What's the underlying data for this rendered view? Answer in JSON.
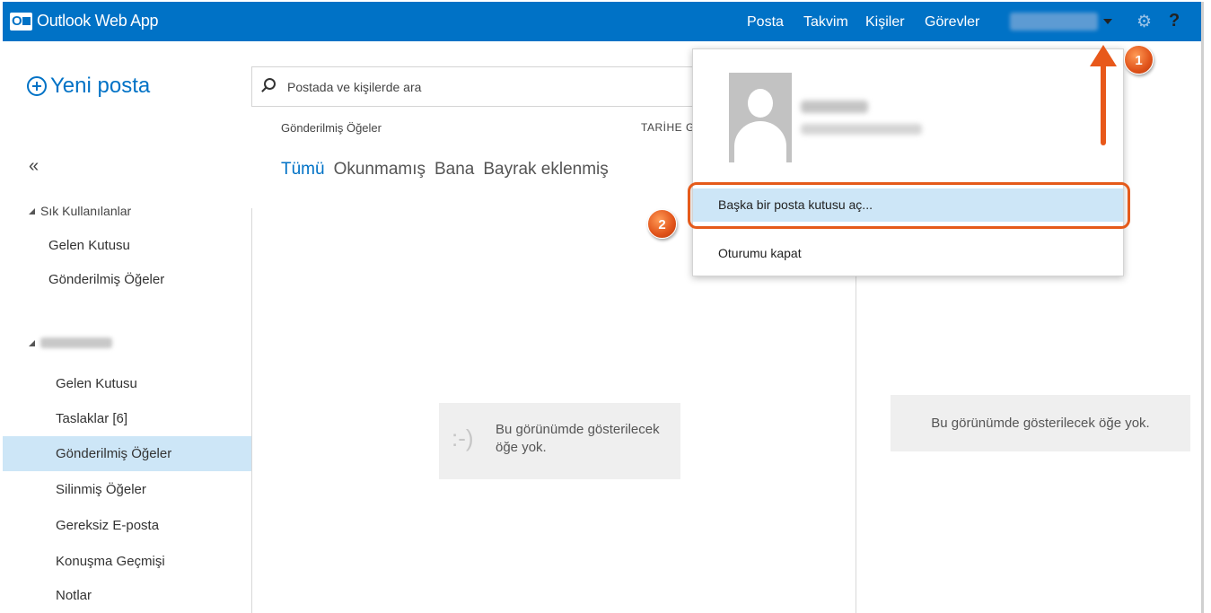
{
  "header": {
    "app_title": "Outlook Web App",
    "logo_letter": "O",
    "nav": [
      "Posta",
      "Takvim",
      "Kişiler",
      "Görevler"
    ],
    "help": "?"
  },
  "sidebar": {
    "new_mail": "Yeni posta",
    "collapse": "«",
    "favorites_title": "Sık Kullanılanlar",
    "favorites": [
      "Gelen Kutusu",
      "Gönderilmiş Öğeler"
    ],
    "folders": [
      "Gelen Kutusu",
      "Taslaklar [6]",
      "Gönderilmiş Öğeler",
      "Silinmiş Öğeler",
      "Gereksiz E-posta",
      "Konuşma Geçmişi",
      "Notlar"
    ],
    "selected_folder": "Gönderilmiş Öğeler"
  },
  "search": {
    "placeholder": "Postada ve kişilerde ara"
  },
  "message_list": {
    "title": "Gönderilmiş Öğeler",
    "sort_label": "TARİHE G",
    "filters": [
      "Tümü",
      "Okunmamış",
      "Bana",
      "Bayrak eklenmiş"
    ],
    "active_filter": "Tümü",
    "smiley": ":-)",
    "empty_text": "Bu görünümde gösterilecek öğe yok."
  },
  "reading_pane": {
    "empty_text": "Bu görünümde gösterilecek öğe yok."
  },
  "account_menu": {
    "open_other_mailbox": "Başka bir posta kutusu aç...",
    "sign_out": "Oturumu kapat"
  },
  "callouts": [
    "1",
    "2"
  ],
  "colors": {
    "brand": "#0072c6",
    "selected_bg": "#cde6f7",
    "callout": "#e8581a"
  }
}
